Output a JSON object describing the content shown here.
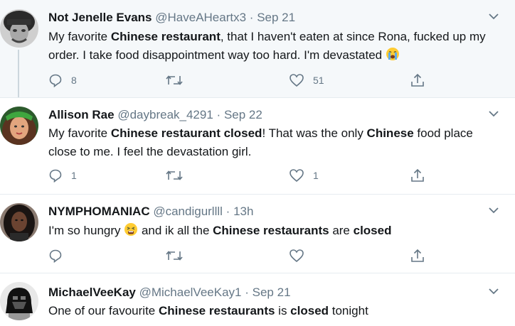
{
  "tweets": [
    {
      "name": "Not Jenelle Evans",
      "handle": "@HaveAHeartx3",
      "sep": "·",
      "time": "Sep 21",
      "text_parts": [
        "My favorite ",
        "Chinese restaurant",
        ", that I haven't eaten at since Rona, fucked up my order. I take food disappointment way too hard. I'm devastated"
      ],
      "emoji": "loudly-crying-face",
      "reply_count": "8",
      "retweet_count": "",
      "like_count": "51"
    },
    {
      "name": "Allison Rae",
      "handle": "@daybreak_4291",
      "sep": "·",
      "time": "Sep 22",
      "text_parts": [
        "My favorite ",
        "Chinese restaurant closed",
        "! That was the only ",
        "Chinese",
        " food place close to me. I feel the devastation girl."
      ],
      "reply_count": "1",
      "retweet_count": "",
      "like_count": "1"
    },
    {
      "name": "NYMPHOMANIAC",
      "handle": "@candigurllll",
      "sep": "·",
      "time": "13h",
      "text_parts": [
        "I'm so hungry ",
        " and ik all the ",
        "Chinese restaurants",
        " are ",
        "closed"
      ],
      "emoji": "tired-face",
      "reply_count": "",
      "retweet_count": "",
      "like_count": ""
    },
    {
      "name": "MichaelVeeKay",
      "handle": "@MichaelVeeKay1",
      "sep": "·",
      "time": "Sep 21",
      "text_parts": [
        "One of our favourite ",
        "Chinese restaurants",
        " is ",
        "closed",
        " tonight"
      ]
    }
  ],
  "colors": {
    "text": "#14171a",
    "secondary": "#657786",
    "border": "#e6ecf0",
    "hover": "#f5f8fa"
  }
}
